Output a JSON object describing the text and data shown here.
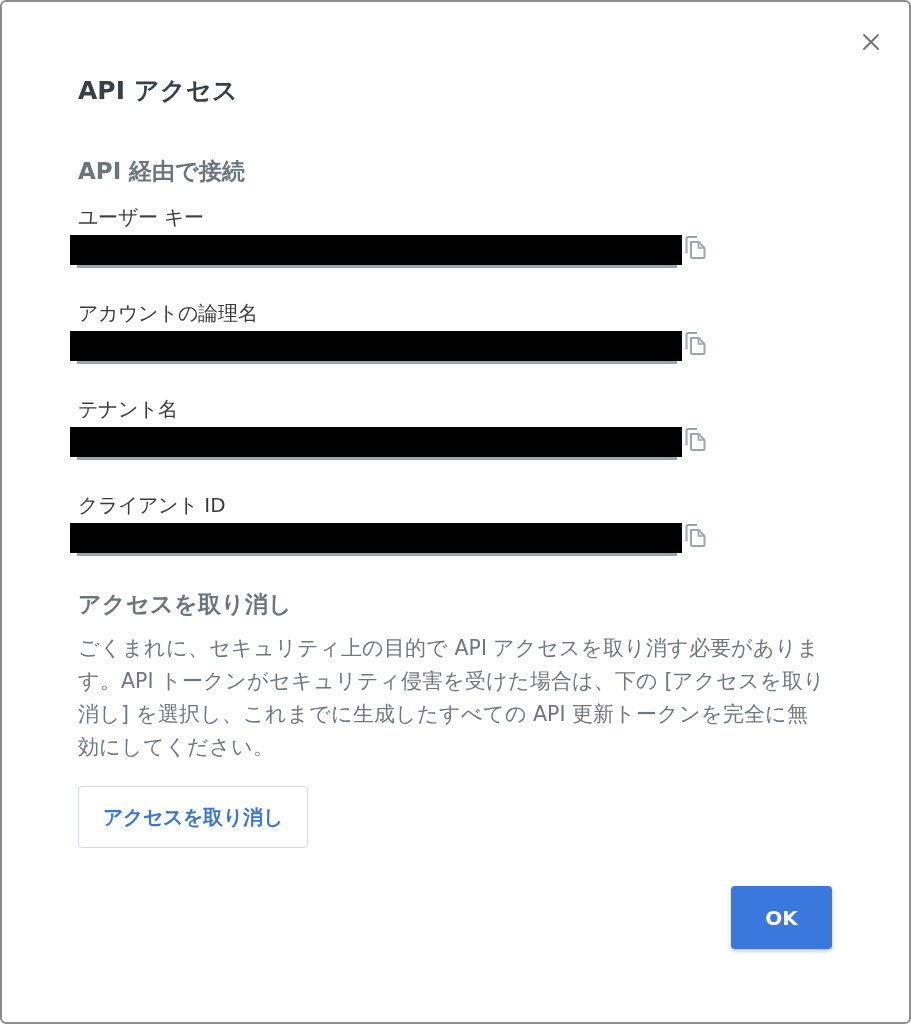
{
  "dialog": {
    "title": "API アクセス"
  },
  "connect_section": {
    "heading": "API 経由で接続",
    "fields": [
      {
        "label": "ユーザー キー",
        "redacted": true
      },
      {
        "label": "アカウントの論理名",
        "redacted": true
      },
      {
        "label": "テナント名",
        "redacted": true
      },
      {
        "label": "クライアント ID",
        "redacted": true
      }
    ]
  },
  "revoke_section": {
    "heading": "アクセスを取り消し",
    "description": "ごくまれに、セキュリティ上の目的で API アクセスを取り消す必要があります。API トークンがセキュリティ侵害を受けた場合は、下の [アクセスを取り消し] を選択し、これまでに生成したすべての API 更新トークンを完全に無効にしてください。",
    "button": "アクセスを取り消し"
  },
  "footer": {
    "ok_button": "OK"
  }
}
